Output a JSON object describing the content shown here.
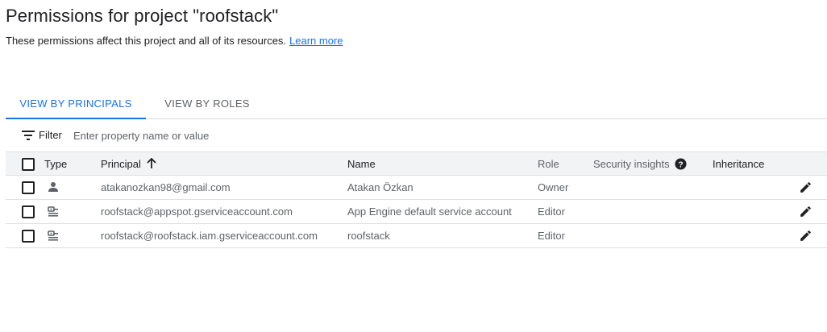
{
  "header": {
    "title": "Permissions for project \"roofstack\"",
    "description": "These permissions affect this project and all of its resources.",
    "learn_more": "Learn more"
  },
  "tabs": [
    {
      "label": "VIEW BY PRINCIPALS",
      "active": true
    },
    {
      "label": "VIEW BY ROLES",
      "active": false
    }
  ],
  "filter": {
    "label": "Filter",
    "placeholder": "Enter property name or value",
    "icon": "filter-icon"
  },
  "table": {
    "columns": {
      "type": "Type",
      "principal": "Principal",
      "name": "Name",
      "role": "Role",
      "security_insights": "Security insights",
      "inheritance": "Inheritance"
    },
    "sort": {
      "column": "principal",
      "direction": "ascending",
      "icon": "arrow-up-icon"
    },
    "rows": [
      {
        "type_icon": "person-icon",
        "principal": "atakanozkan98@gmail.com",
        "name": "Atakan Özkan",
        "role": "Owner"
      },
      {
        "type_icon": "service-account-icon",
        "principal": "roofstack@appspot.gserviceaccount.com",
        "name": "App Engine default service account",
        "role": "Editor"
      },
      {
        "type_icon": "service-account-icon",
        "principal": "roofstack@roofstack.iam.gserviceaccount.com",
        "name": "roofstack",
        "role": "Editor"
      }
    ]
  },
  "colors": {
    "accent": "#1a73e8",
    "text": "#202124",
    "muted": "#5f6368",
    "header_bg": "#f1f3f4"
  }
}
